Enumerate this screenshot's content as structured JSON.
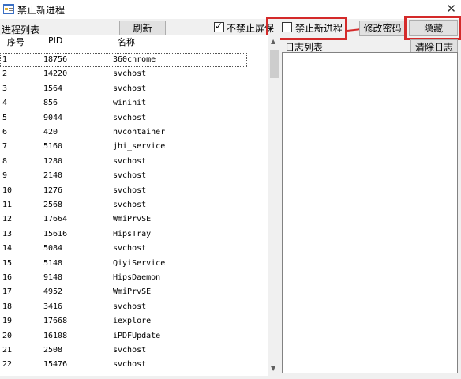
{
  "window": {
    "title": "禁止新进程"
  },
  "toolbar": {
    "refresh_label": "刷新",
    "no_block_label": "不禁止屏保",
    "no_block_checked": true,
    "block_new_label": "禁止新进程",
    "block_new_checked": false,
    "change_password_label": "修改密码",
    "hide_label": "隐藏"
  },
  "process_panel": {
    "title": "进程列表",
    "headers": [
      "序号",
      "PID",
      "名称"
    ],
    "rows": [
      [
        "1",
        "18756",
        "360chrome"
      ],
      [
        "2",
        "14220",
        "svchost"
      ],
      [
        "3",
        "1564",
        "svchost"
      ],
      [
        "4",
        "856",
        "wininit"
      ],
      [
        "5",
        "9044",
        "svchost"
      ],
      [
        "6",
        "420",
        "nvcontainer"
      ],
      [
        "7",
        "5160",
        "jhi_service"
      ],
      [
        "8",
        "1280",
        "svchost"
      ],
      [
        "9",
        "2140",
        "svchost"
      ],
      [
        "10",
        "1276",
        "svchost"
      ],
      [
        "11",
        "2568",
        "svchost"
      ],
      [
        "12",
        "17664",
        "WmiPrvSE"
      ],
      [
        "13",
        "15616",
        "HipsTray"
      ],
      [
        "14",
        "5084",
        "svchost"
      ],
      [
        "15",
        "5148",
        "QiyiService"
      ],
      [
        "16",
        "9148",
        "HipsDaemon"
      ],
      [
        "17",
        "4952",
        "WmiPrvSE"
      ],
      [
        "18",
        "3416",
        "svchost"
      ],
      [
        "19",
        "17668",
        "iexplore"
      ],
      [
        "20",
        "16108",
        "iPDFUpdate"
      ],
      [
        "21",
        "2508",
        "svchost"
      ],
      [
        "22",
        "15476",
        "svchost"
      ]
    ]
  },
  "log_panel": {
    "title": "日志列表",
    "clear_label": "清除日志"
  },
  "colors": {
    "highlight_border": "#d42a2a"
  }
}
